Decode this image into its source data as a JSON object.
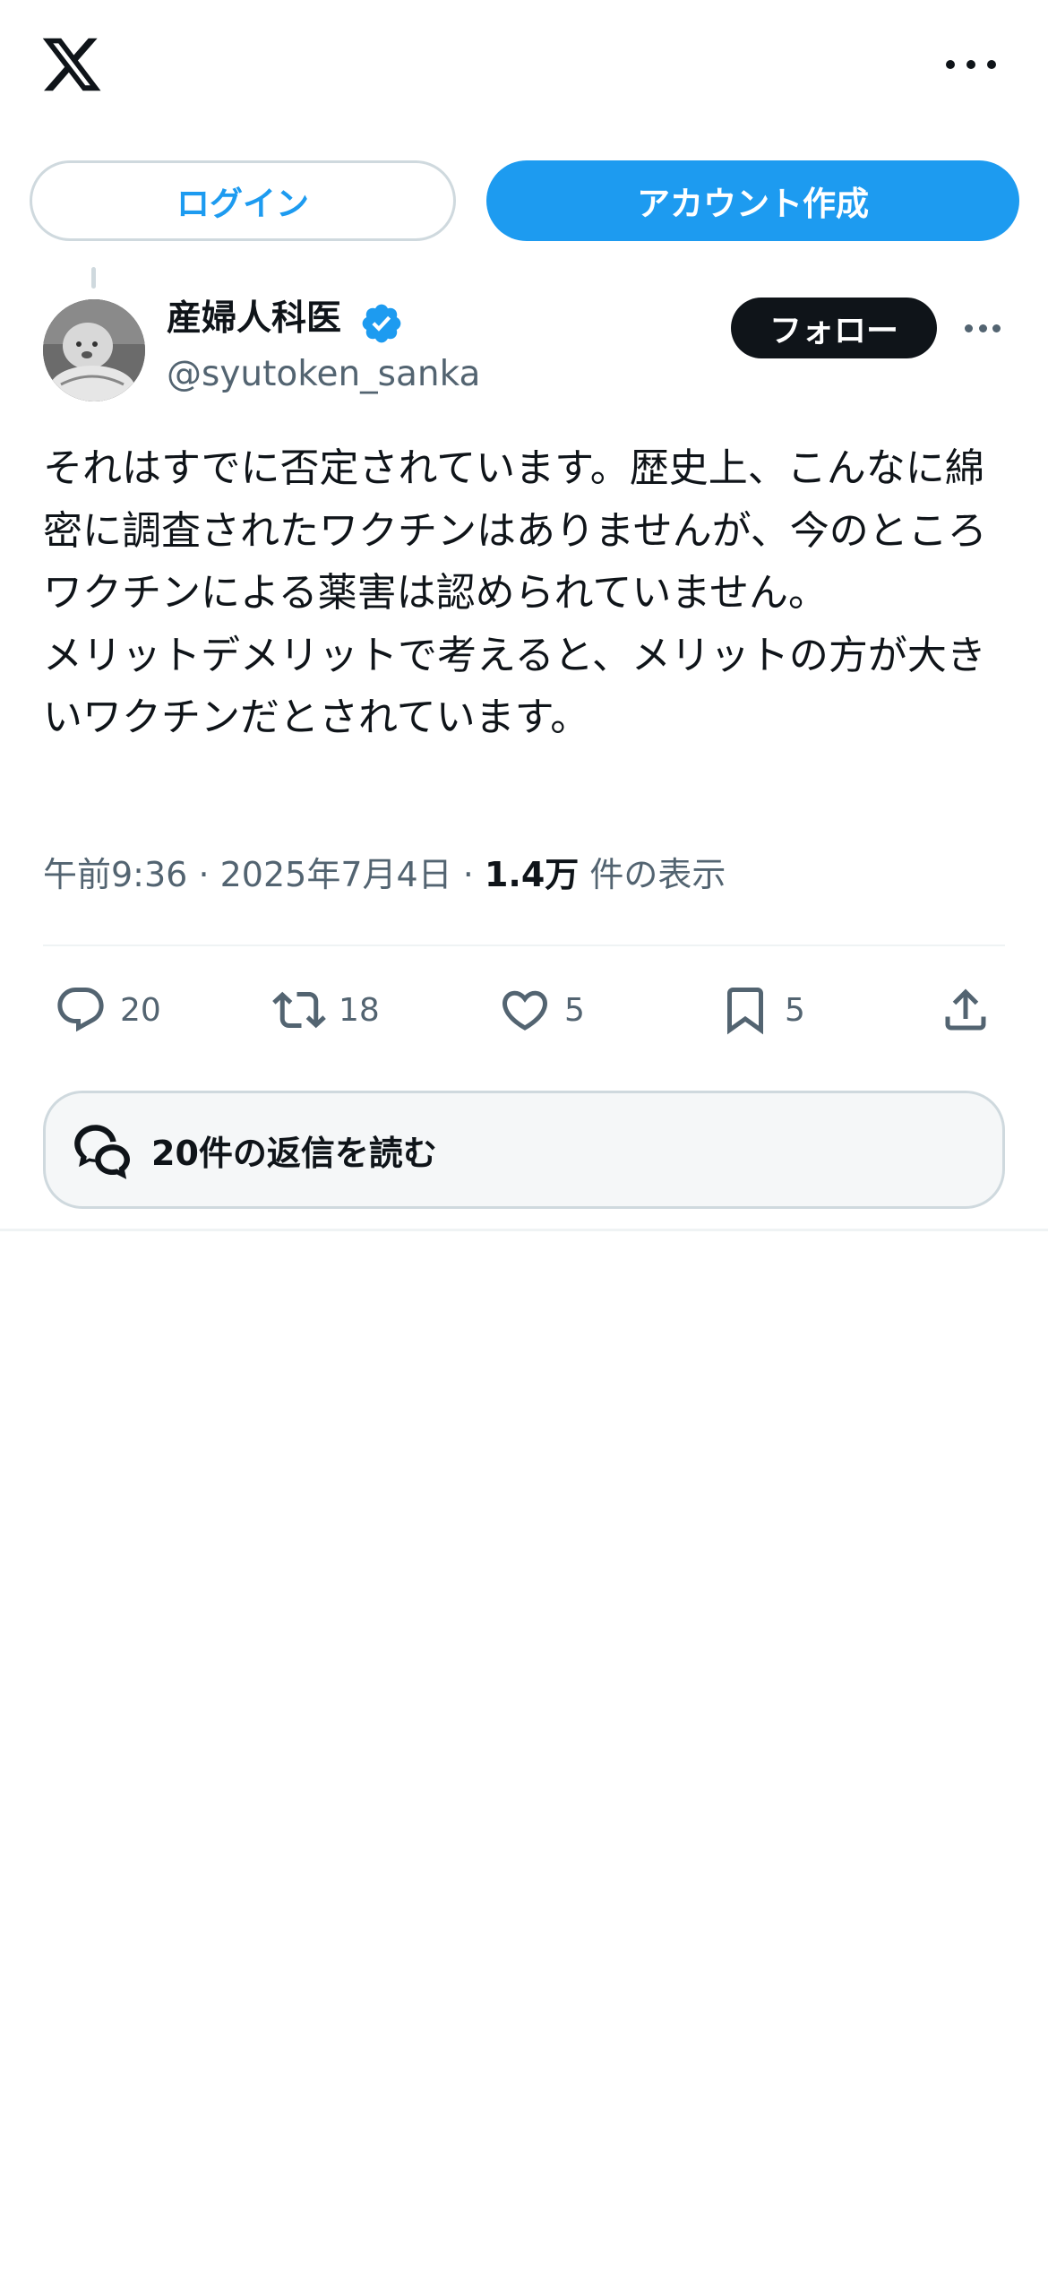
{
  "header": {
    "logo_icon": "x-logo-icon",
    "more_icon": "more-horizontal-icon"
  },
  "auth": {
    "login_label": "ログイン",
    "signup_label": "アカウント作成"
  },
  "post": {
    "author_name": "産婦人科医",
    "verified_icon": "verified-badge-icon",
    "handle": "@syutoken_sanka",
    "follow_label": "フォロー",
    "text": "それはすでに否定されています。歴史上、こんなに綿密に調査されたワクチンはありませんが、今のところワクチンによる薬害は認められていません。\nメリットデメリットで考えると、メリットの方が大きいワクチンだとされています。",
    "time": "午前9:36",
    "separator": "·",
    "date": "2025年7月4日",
    "views_count": "1.4万",
    "views_label": "件の表示"
  },
  "actions": {
    "reply_count": "20",
    "repost_count": "18",
    "like_count": "5",
    "bookmark_count": "5"
  },
  "replies": {
    "read_label": "20件の返信を読む"
  },
  "colors": {
    "accent": "#1d9bf0",
    "text": "#0f1419",
    "secondary": "#536471",
    "border": "#cfd9de"
  }
}
